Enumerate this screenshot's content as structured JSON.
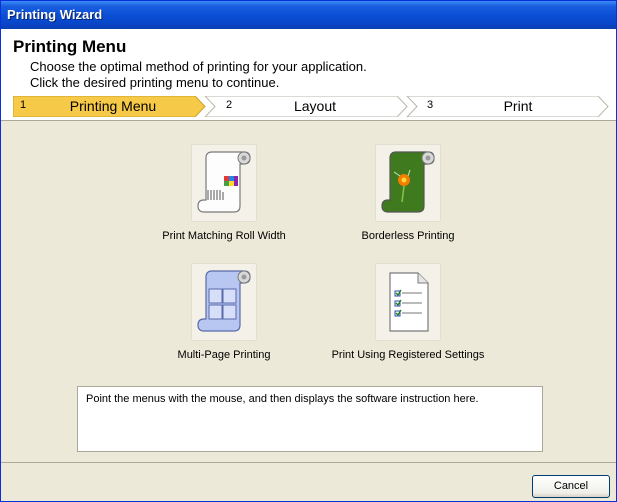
{
  "window": {
    "title": "Printing Wizard"
  },
  "header": {
    "title": "Printing Menu",
    "line1": "Choose the optimal method of printing for your application.",
    "line2": "Click the desired printing menu to continue."
  },
  "steps": [
    {
      "num": "1",
      "label": "Printing Menu",
      "active": true
    },
    {
      "num": "2",
      "label": "Layout",
      "active": false
    },
    {
      "num": "3",
      "label": "Print",
      "active": false
    }
  ],
  "menu": [
    {
      "label": "Print Matching Roll Width",
      "icon": "roll-width-icon"
    },
    {
      "label": "Borderless Printing",
      "icon": "borderless-icon"
    },
    {
      "label": "Multi-Page Printing",
      "icon": "multi-page-icon"
    },
    {
      "label": "Print Using Registered Settings",
      "icon": "registered-settings-icon"
    }
  ],
  "info": {
    "text": "Point the menus with the mouse, and then displays the software instruction here."
  },
  "buttons": {
    "cancel": "Cancel"
  },
  "colors": {
    "active_step": "#f7c948",
    "titlebar": "#0a4fd6"
  }
}
